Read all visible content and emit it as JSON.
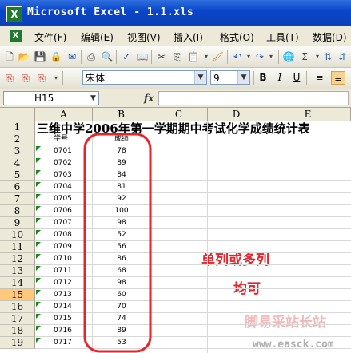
{
  "window": {
    "title": "Microsoft Excel - 1.1.xls",
    "app_icon": "excel-icon"
  },
  "menu": [
    "文件(F)",
    "编辑(E)",
    "视图(V)",
    "插入(I)",
    "格式(O)",
    "工具(T)",
    "数据(D)"
  ],
  "format_bar": {
    "font_name": "宋体",
    "font_size": "9",
    "bold": "B",
    "italic": "I",
    "underline": "U"
  },
  "formula_bar": {
    "name_box": "H15",
    "fx": "fx",
    "value": ""
  },
  "columns": [
    "A",
    "B",
    "C",
    "D",
    "E"
  ],
  "rows": [
    "1",
    "2",
    "3",
    "4",
    "5",
    "6",
    "7",
    "8",
    "9",
    "10",
    "11",
    "12",
    "13",
    "14",
    "15",
    "16",
    "17",
    "18",
    "19"
  ],
  "selected_row": "15",
  "sheet": {
    "title": "三维中学2006年第一学期期中考试化学成绩统计表",
    "header": {
      "a": "学号",
      "b": "成绩"
    },
    "data": [
      {
        "id": "0701",
        "score": "78"
      },
      {
        "id": "0702",
        "score": "89"
      },
      {
        "id": "0703",
        "score": "84"
      },
      {
        "id": "0704",
        "score": "81"
      },
      {
        "id": "0705",
        "score": "92"
      },
      {
        "id": "0706",
        "score": "100"
      },
      {
        "id": "0707",
        "score": "98"
      },
      {
        "id": "0708",
        "score": "52"
      },
      {
        "id": "0709",
        "score": "56"
      },
      {
        "id": "0710",
        "score": "86"
      },
      {
        "id": "0711",
        "score": "68"
      },
      {
        "id": "0712",
        "score": "98"
      },
      {
        "id": "0713",
        "score": "60"
      },
      {
        "id": "0714",
        "score": "70"
      },
      {
        "id": "0715",
        "score": "74"
      },
      {
        "id": "0716",
        "score": "89"
      },
      {
        "id": "0717",
        "score": "53"
      }
    ]
  },
  "annotation": {
    "line1": "单列或多列",
    "line2": "均可",
    "color": "#e8232a"
  },
  "watermark": {
    "cn": "脚易采站长站",
    "url": "www.easck.com"
  }
}
